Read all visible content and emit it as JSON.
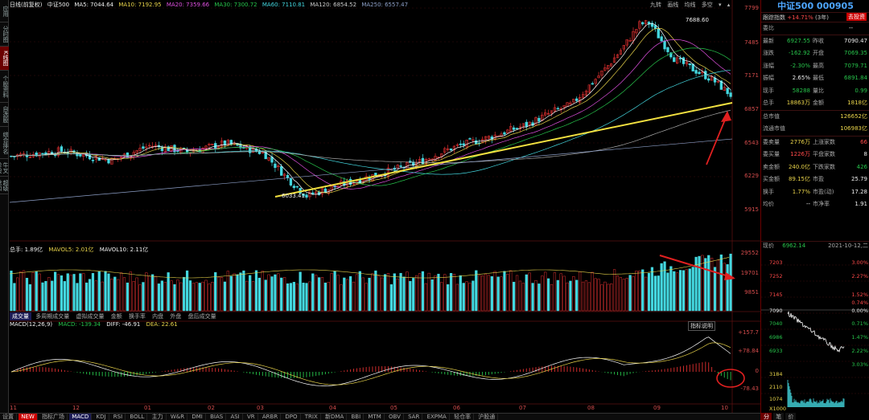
{
  "left_tabs": [
    "应用",
    "分时图",
    "K线图",
    "个股资料",
    "自选股",
    "综合排名",
    "牛叉诊股",
    "超级盘口"
  ],
  "header": {
    "period": "日线(前复权)",
    "index_name": "中证500",
    "ma5": "MA5: 7044.64",
    "ma10": "MA10: 7192.95",
    "ma20": "MA20: 7359.66",
    "ma30": "MA30: 7300.72",
    "ma60": "MA60: 7110.81",
    "ma120": "MA120: 6854.52",
    "ma250": "MA250: 6557.47"
  },
  "top_right_tools": [
    "九转",
    "画线",
    "均线",
    "多空"
  ],
  "colors": {
    "ma5": "#ffffff",
    "ma10": "#e8d34a",
    "ma20": "#e050e0",
    "ma30": "#27c44b",
    "ma60": "#44d8e0",
    "ma120": "#aaaaaa",
    "ma250": "#8ea0c8",
    "up": "#e03030",
    "down": "#44d8e0",
    "trend": "#f2e040",
    "arrow": "#e02020",
    "accent": "#4da6ff"
  },
  "price_axis": [
    "7799",
    "7485",
    "7171",
    "6857",
    "6543",
    "6229",
    "5915"
  ],
  "annotations": {
    "high": "7688.60",
    "low": "6033.41"
  },
  "volume": {
    "header": {
      "label": "总手: 1.89亿",
      "mavol5": "MAVOL5: 2.01亿",
      "mavol10": "MAVOL10: 2.11亿"
    },
    "axis": [
      "29552",
      "19701",
      "9851"
    ],
    "tabs": [
      "成交量",
      "多周期成交量",
      "虚拟成交量",
      "金额",
      "换手率",
      "内盘",
      "外盘",
      "盘后成交量"
    ]
  },
  "macd": {
    "header": {
      "params": "MACD(12,26,9)",
      "macd": "MACD: -139.34",
      "diff": "DIFF: -46.91",
      "dea": "DEA: 22.61"
    },
    "button": "指标说明",
    "axis": [
      "+157.7",
      "+78.84",
      "0",
      "-78.43"
    ]
  },
  "months": [
    "11",
    "12",
    "01",
    "02",
    "03",
    "04",
    "05",
    "06",
    "07",
    "08",
    "09",
    "10"
  ],
  "indicator_bar": [
    "设置",
    "NEW",
    "指标广场",
    "MACD",
    "KDJ",
    "RSI",
    "BOLL",
    "主力",
    "W&R",
    "DMI",
    "BIAS",
    "ASI",
    "VR",
    "ARBR",
    "DPO",
    "TRIX",
    "新DMA",
    "BBI",
    "MTM",
    "OBV",
    "SAR",
    "EXPMA",
    "轻仓率",
    "沪股通"
  ],
  "right_panel": {
    "title": "中证500 000905",
    "sub_label": "跟踪指数",
    "sub_pct": "+14.71%",
    "sub_period": "(3年)",
    "sub_button": "去投资",
    "wei_bi": {
      "label": "委比",
      "value": "--"
    },
    "rows1": [
      {
        "l1": "最新",
        "v1": "6927.55",
        "l2": "昨收",
        "v2": "7090.47"
      },
      {
        "l1": "涨跌",
        "v1": "-162.92",
        "l2": "开盘",
        "v2": "7069.35"
      },
      {
        "l1": "涨幅",
        "v1": "-2.30%",
        "l2": "最高",
        "v2": "7079.71"
      },
      {
        "l1": "振幅",
        "v1": "2.65%",
        "l2": "最低",
        "v2": "6891.84"
      },
      {
        "l1": "现手",
        "v1": "58288",
        "l2": "量比",
        "v2": "0.99"
      },
      {
        "l1": "总手",
        "v1": "18863万",
        "l2": "金额",
        "v2": "1818亿"
      }
    ],
    "rows2": [
      {
        "l1": "总市值",
        "full": "126652亿"
      },
      {
        "l1": "流通市值",
        "full": "106983亿"
      }
    ],
    "rows3": [
      {
        "l1": "委卖量",
        "v1": "2776万",
        "l2": "上涨家数",
        "v2": "66"
      },
      {
        "l1": "委买量",
        "v1": "1226万",
        "l2": "平盘家数",
        "v2": "8"
      },
      {
        "l1": "卖金额",
        "v1": "240.0亿",
        "l2": "下跌家数",
        "v2": "426"
      },
      {
        "l1": "买金额",
        "v1": "89.15亿",
        "l2": "市盈",
        "v2": "25.79"
      },
      {
        "l1": "换手",
        "v1": "1.77%",
        "l2": "市盈(动)",
        "v2": "17.28"
      },
      {
        "l1": "均价",
        "v1": "--",
        "l2": "市净率",
        "v2": "1.91"
      }
    ],
    "mini_chart": {
      "label": "现价",
      "price": "6962.14",
      "date": "2021-10-12,二",
      "price_axis": [
        "7203",
        "7252",
        "7145",
        "7090",
        "7040",
        "6986",
        "6933"
      ],
      "pct_axis": [
        "3.00%",
        "2.27%",
        "1.52%",
        "0.74%",
        "0.00%",
        "0.71%",
        "1.47%",
        "2.22%",
        "3.03%"
      ],
      "vol_axis": [
        "3184",
        "2110",
        "1074",
        "X1000"
      ]
    },
    "tabs": [
      "分",
      "笔",
      "价"
    ]
  }
}
